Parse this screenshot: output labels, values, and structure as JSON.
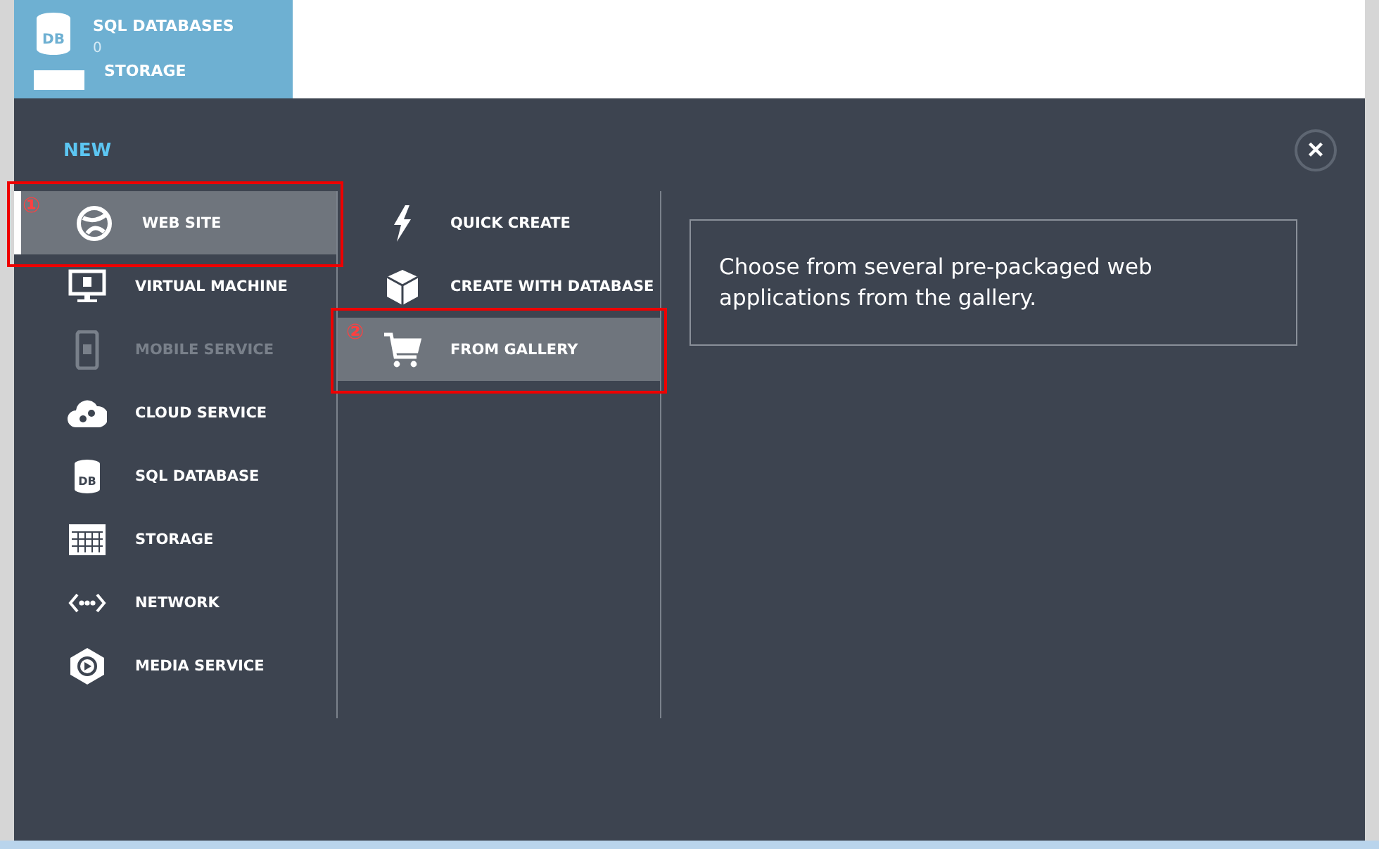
{
  "background_tile": {
    "icon_text": "DB",
    "title": "SQL DATABASES",
    "count": "0",
    "next_title": "STORAGE"
  },
  "panel": {
    "title": "NEW",
    "close": "×"
  },
  "categories": [
    {
      "label": "WEB SITE",
      "kind": "globe",
      "selected": true,
      "disabled": false,
      "marker": "①"
    },
    {
      "label": "VIRTUAL MACHINE",
      "kind": "monitor",
      "selected": false,
      "disabled": false
    },
    {
      "label": "MOBILE SERVICE",
      "kind": "phone",
      "selected": false,
      "disabled": true
    },
    {
      "label": "CLOUD SERVICE",
      "kind": "cloud",
      "selected": false,
      "disabled": false
    },
    {
      "label": "SQL DATABASE",
      "kind": "db",
      "icon_text": "DB",
      "selected": false,
      "disabled": false
    },
    {
      "label": "STORAGE",
      "kind": "grid",
      "selected": false,
      "disabled": false
    },
    {
      "label": "NETWORK",
      "kind": "network",
      "selected": false,
      "disabled": false
    },
    {
      "label": "MEDIA SERVICE",
      "kind": "media",
      "selected": false,
      "disabled": false
    }
  ],
  "options": [
    {
      "label": "QUICK CREATE",
      "kind": "bolt",
      "selected": false
    },
    {
      "label": "CREATE WITH DATABASE",
      "kind": "box",
      "selected": false
    },
    {
      "label": "FROM GALLERY",
      "kind": "cart",
      "selected": true,
      "marker": "②"
    }
  ],
  "description": "Choose from several pre-packaged web applications from the gallery."
}
